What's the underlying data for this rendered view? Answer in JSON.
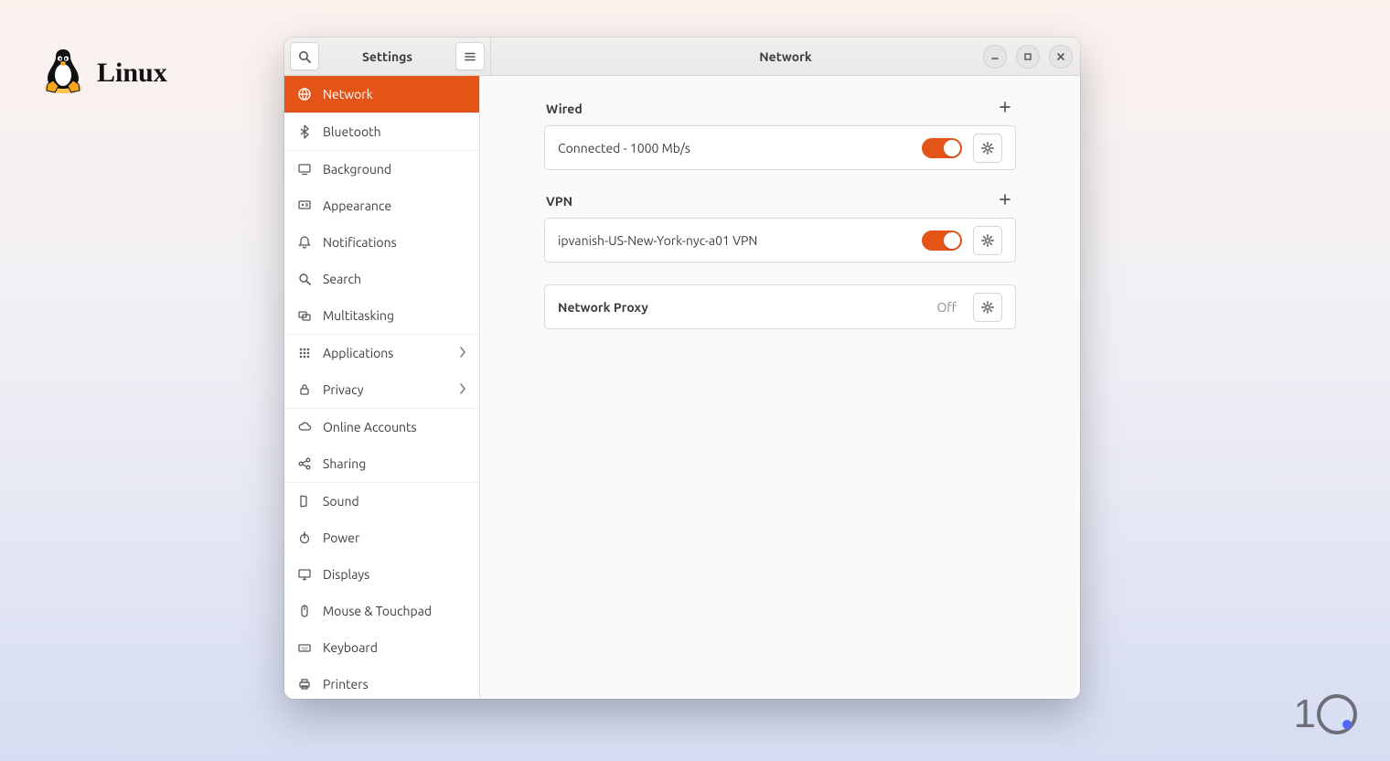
{
  "os_label": "Linux",
  "title": {
    "sidebar": "Settings",
    "main": "Network"
  },
  "sidebar": {
    "items": [
      {
        "label": "Network"
      },
      {
        "label": "Bluetooth"
      },
      {
        "label": "Background"
      },
      {
        "label": "Appearance"
      },
      {
        "label": "Notifications"
      },
      {
        "label": "Search"
      },
      {
        "label": "Multitasking"
      },
      {
        "label": "Applications"
      },
      {
        "label": "Privacy"
      },
      {
        "label": "Online Accounts"
      },
      {
        "label": "Sharing"
      },
      {
        "label": "Sound"
      },
      {
        "label": "Power"
      },
      {
        "label": "Displays"
      },
      {
        "label": "Mouse & Touchpad"
      },
      {
        "label": "Keyboard"
      },
      {
        "label": "Printers"
      }
    ]
  },
  "sections": {
    "wired": {
      "title": "Wired",
      "row": "Connected - 1000 Mb/s"
    },
    "vpn": {
      "title": "VPN",
      "row": "ipvanish-US-New-York-nyc-a01 VPN"
    },
    "proxy": {
      "label": "Network Proxy",
      "status": "Off"
    }
  },
  "colors": {
    "accent": "#e35416"
  }
}
